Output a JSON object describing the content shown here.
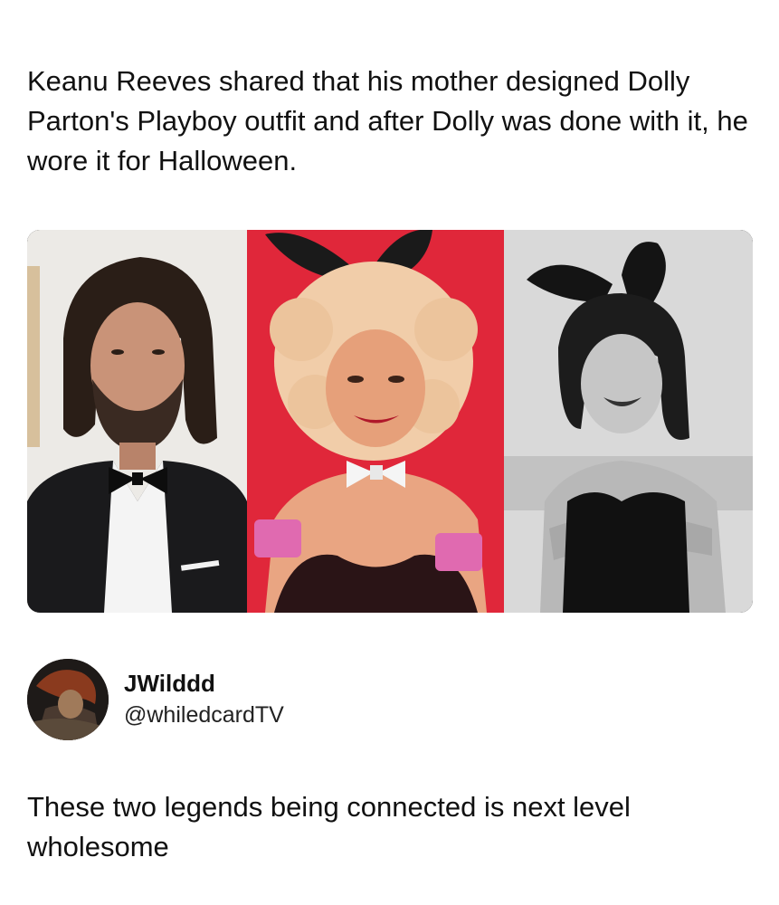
{
  "post": {
    "text": "Keanu Reeves shared that his mother designed Dolly Parton's Playboy outfit and after Dolly was done with it, he wore it for Halloween."
  },
  "images": [
    {
      "name": "photo-man-in-tuxedo",
      "icon": "man-in-tuxedo-photo"
    },
    {
      "name": "photo-woman-bunny-costume",
      "icon": "woman-in-bunny-costume-photo",
      "background": "#e0273a"
    },
    {
      "name": "photo-man-bunny-costume",
      "icon": "man-in-bunny-costume-photo"
    }
  ],
  "reply": {
    "display_name": "JWilddd",
    "handle": "@whiledcardTV",
    "text": "These two legends being connected is next level wholesome"
  },
  "colors": {
    "text": "#111111",
    "background": "#ffffff",
    "accent_red": "#e0273a"
  }
}
